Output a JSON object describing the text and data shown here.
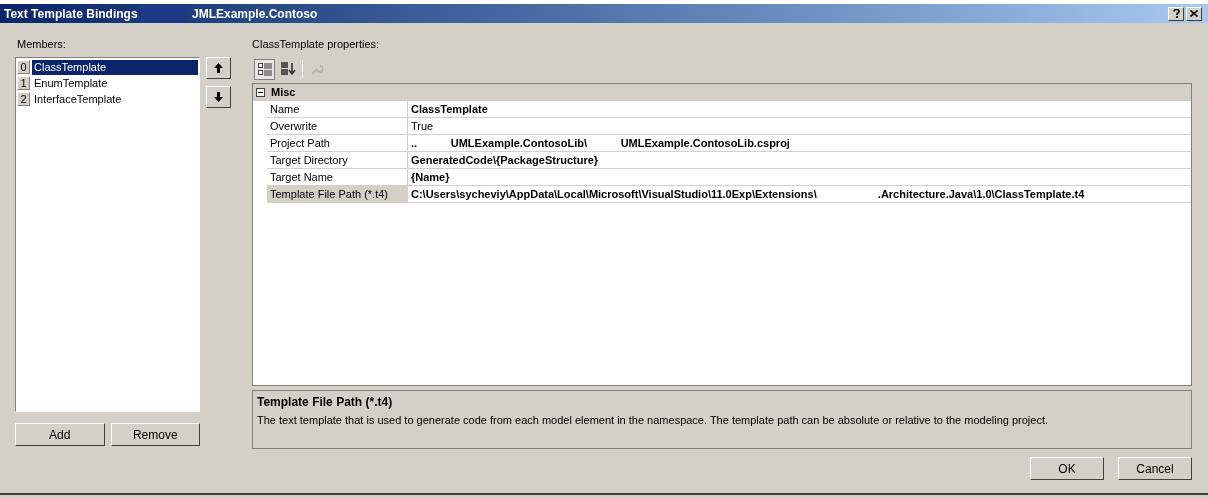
{
  "window": {
    "title": "Text Template Bindings",
    "subtitle": "JMLExample.Contoso"
  },
  "members": {
    "label": "Members:",
    "items": [
      {
        "index": "0",
        "name": "ClassTemplate",
        "selected": true
      },
      {
        "index": "1",
        "name": "EnumTemplate",
        "selected": false
      },
      {
        "index": "2",
        "name": "InterfaceTemplate",
        "selected": false
      }
    ],
    "buttons": [
      "Add",
      "Remove"
    ]
  },
  "properties": {
    "label": "ClassTemplate properties:",
    "category": {
      "name": "Misc",
      "expanded": true
    },
    "rows": [
      {
        "name": "Name",
        "value": "ClassTemplate",
        "bold": true,
        "selected": false
      },
      {
        "name": "Overwrite",
        "value": "True",
        "bold": false,
        "selected": false
      },
      {
        "name": "Project Path",
        "value": "..           UMLExample.ContosoLib\\           UMLExample.ContosoLib.csproj",
        "bold": true,
        "selected": false
      },
      {
        "name": "Target Directory",
        "value": "GeneratedCode\\{PackageStructure}",
        "bold": true,
        "selected": false
      },
      {
        "name": "Target Name",
        "value": "{Name}",
        "bold": true,
        "selected": false
      },
      {
        "name": "Template File Path (*.t4)",
        "value": "C:\\Users\\sycheviy\\AppData\\Local\\Microsoft\\VisualStudio\\11.0Exp\\Extensions\\                    .Architecture.Java\\1.0\\ClassTemplate.t4",
        "bold": true,
        "selected": true
      }
    ],
    "description": {
      "title": "Template File Path (*.t4)",
      "text": "The text template that is used to generate code from each model element in the namespace. The template path can be absolute or relative to the modeling project."
    }
  },
  "dialog_buttons": [
    "OK",
    "Cancel"
  ]
}
